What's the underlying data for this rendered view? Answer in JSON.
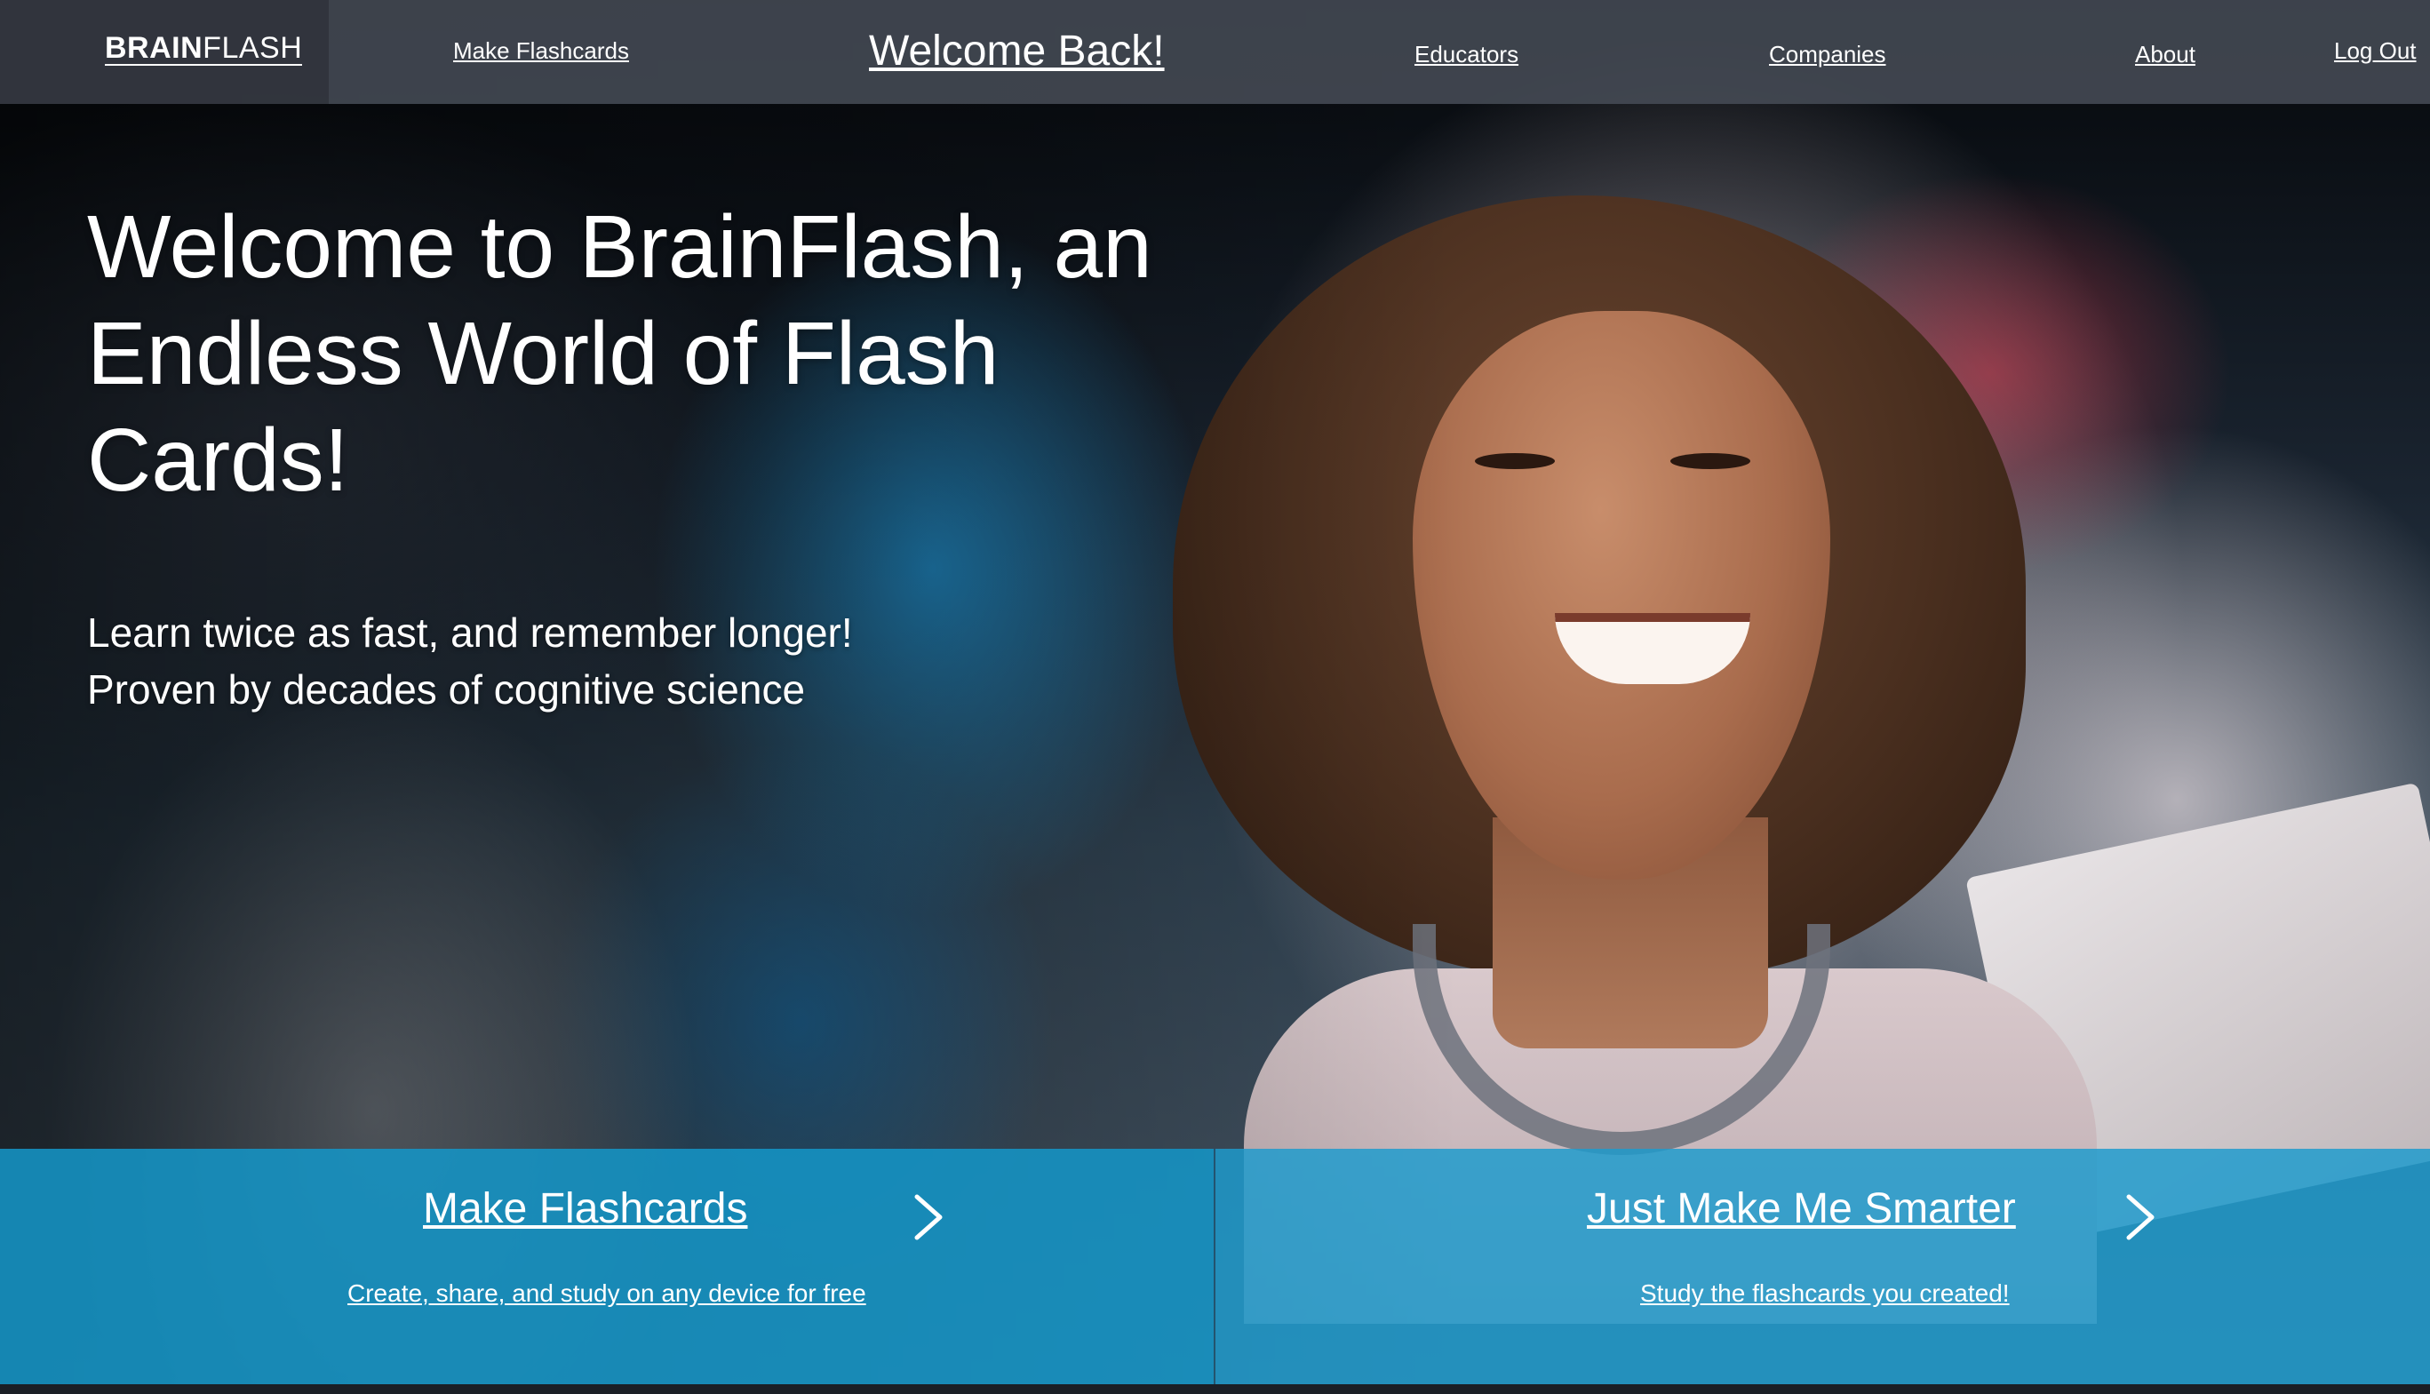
{
  "nav": {
    "logo_bold": "BRAIN",
    "logo_light": "FLASH",
    "make_flashcards": "Make Flashcards",
    "welcome": "Welcome Back!",
    "educators": "Educators",
    "companies": "Companies",
    "about": "About",
    "logout": "Log Out"
  },
  "hero": {
    "headline": "Welcome to BrainFlash, an Endless World of Flash Cards!",
    "subline_1": "Learn twice as fast, and remember longer!",
    "subline_2": "Proven by decades of cognitive science"
  },
  "cta": {
    "left": {
      "title": "Make Flashcards",
      "subtitle": "Create, share, and study on any device for free",
      "icon": "chevron-right-icon"
    },
    "right": {
      "title": "Just Make Me Smarter",
      "subtitle": "Study the flashcards you created!",
      "icon": "chevron-right-icon"
    }
  },
  "colors": {
    "nav_bg": "#464b55",
    "cta_bg": "#1496c8",
    "text": "#ffffff"
  }
}
